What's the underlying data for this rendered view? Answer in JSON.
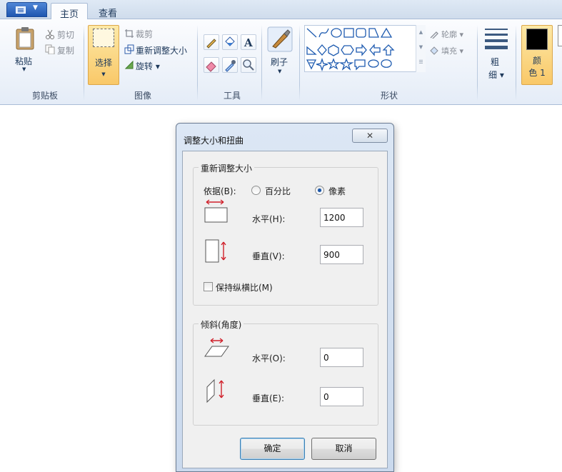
{
  "ribbon": {
    "tabs": [
      "主页",
      "查看"
    ],
    "clipboard": {
      "paste": "粘贴",
      "cut": "剪切",
      "copy": "复制",
      "group": "剪贴板"
    },
    "image": {
      "select": "选择",
      "crop": "裁剪",
      "resize": "重新调整大小",
      "rotate": "旋转 ▾",
      "group": "图像"
    },
    "tools": {
      "group": "工具"
    },
    "brushes": {
      "label": "刷子"
    },
    "shapes": {
      "outline": "轮廓 ▾",
      "fill": "填充 ▾",
      "group": "形状"
    },
    "size": {
      "label1": "粗",
      "label2": "细 ▾"
    },
    "color1": {
      "label1": "颜",
      "label2": "色 1",
      "swatch": "#000000"
    },
    "accent": "#f9c868"
  },
  "dialog": {
    "title": "调整大小和扭曲",
    "resize": {
      "legend": "重新调整大小",
      "by_label": "依据(B):",
      "option_percent": "百分比",
      "option_pixels": "像素",
      "selected": "像素",
      "horizontal_label": "水平(H):",
      "horizontal_value": "1200",
      "vertical_label": "垂直(V):",
      "vertical_value": "900",
      "keep_ratio_label": "保持纵横比(M)",
      "keep_ratio_checked": false
    },
    "skew": {
      "legend": "倾斜(角度)",
      "horizontal_label": "水平(O):",
      "horizontal_value": "0",
      "vertical_label": "垂直(E):",
      "vertical_value": "0"
    },
    "ok": "确定",
    "cancel": "取消"
  }
}
